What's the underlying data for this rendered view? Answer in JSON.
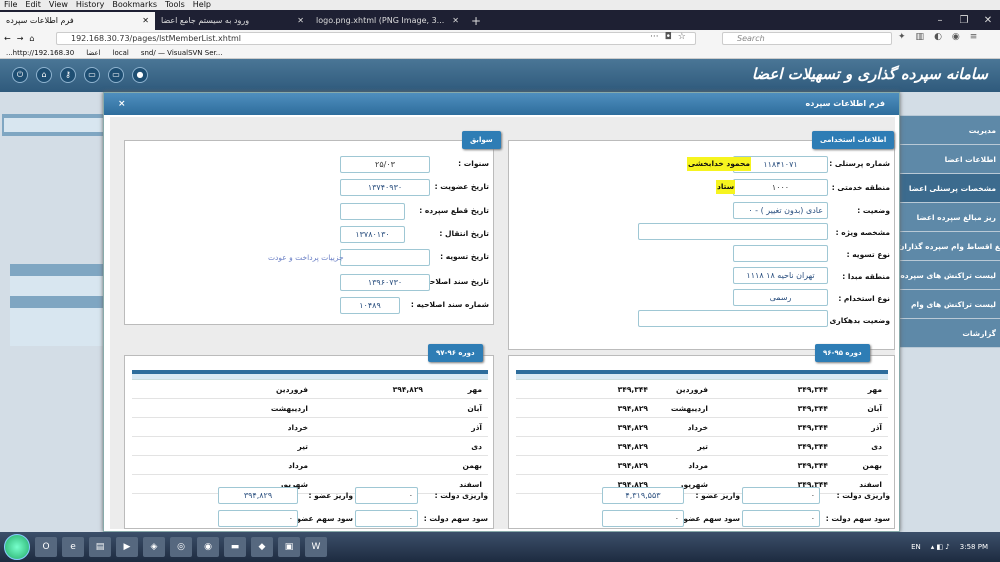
{
  "browser": {
    "menu": [
      "File",
      "Edit",
      "View",
      "History",
      "Bookmarks",
      "Tools",
      "Help"
    ],
    "tabs": [
      {
        "label": "فرم اطلاعات سپرده"
      },
      {
        "label": "ورود به سیستم جامع اعضا"
      },
      {
        "label": "logo.png.xhtml (PNG Image, 3..."
      }
    ],
    "url": "192.168.30.73/pages/lstMemberList.xhtml",
    "search_placeholder": "Search",
    "bookmarks": [
      "...http://192.168.30",
      "اعضا",
      "local",
      "snd/ — VisualSVN Ser..."
    ]
  },
  "app": {
    "title": "سامانه سپرده گذاری و تسهیلات اعضا"
  },
  "sidebar": {
    "items": [
      "مدیریت",
      "اطلاعات اعضا",
      "مشخصات پرسنلی اعضا",
      "ریز مبالغ سپرده اعضا",
      "مبالغ اقساط وام سپرده گذاران",
      "لیست تراکنش های سپرده",
      "لیست تراکنش های وام",
      "گزارشات"
    ]
  },
  "modal": {
    "title": "فرم اطلاعات سپرده",
    "close": "×"
  },
  "employment": {
    "legend": "اطلاعات استخدامی",
    "labels": {
      "personnel": "شماره پرسنلی :",
      "service": "منطقه خدمتی :",
      "status": "وضعیت :",
      "special": "مشخصه ویژه :",
      "settle_type": "نوع تسویه :",
      "origin": "منطقه مبدا :",
      "hire_type": "نوع استخدام :",
      "debt": "وضعیت بدهکاری :"
    },
    "personnel": "۱۱۸۴۱۰۷۱",
    "name": "محمود خدابخشی",
    "service": "۱۰۰۰",
    "service_name": "ستاد",
    "status": "۰ - عادی (بدون تغییر )",
    "special": "",
    "settle_type": "",
    "origin": "۱۱۱۸ تهران ناحیه ۱۸",
    "hire_type": "رسمی",
    "debt": ""
  },
  "history": {
    "legend": "سوابق",
    "labels": {
      "years": "سنوات :",
      "membership_date": "تاریخ عضویت :",
      "cut_date": "تاریخ قطع سپرده :",
      "transfer_date": "تاریخ انتقال :",
      "settle_date": "تاریخ تسویه :",
      "amend_date": "تاریخ سند اصلاحیه :",
      "amend_no": "شماره سند اصلاحیه :"
    },
    "years": "۲۵/۰۳",
    "membership_date": "۱۳۷۴۰۹۳۰",
    "cut_date": "",
    "transfer_date": "۱۳۷۸۰۱۳۰",
    "settle_date": "",
    "amend_date": "۱۳۹۶۰۷۳۰",
    "amend_no": "۱۰۴۸۹",
    "link": "جزییات پرداخت و عودت"
  },
  "period_right": {
    "legend": "دوره ۹۵-۹۶",
    "rows": [
      {
        "m1": "مهر",
        "v1": "۳۴۹,۳۴۴",
        "m2": "فروردین",
        "v2": "۳۴۹,۳۴۴"
      },
      {
        "m1": "آبان",
        "v1": "۳۴۹,۳۴۴",
        "m2": "اردیبهشت",
        "v2": "۳۹۴,۸۲۹"
      },
      {
        "m1": "آذر",
        "v1": "۳۴۹,۳۴۴",
        "m2": "خرداد",
        "v2": "۳۹۴,۸۲۹"
      },
      {
        "m1": "دی",
        "v1": "۳۴۹,۳۴۴",
        "m2": "تیر",
        "v2": "۳۹۴,۸۲۹"
      },
      {
        "m1": "بهمن",
        "v1": "۳۴۹,۳۴۴",
        "m2": "مرداد",
        "v2": "۳۹۴,۸۲۹"
      },
      {
        "m1": "اسفند",
        "v1": "۳۴۹,۳۴۴",
        "m2": "شهریور",
        "v2": "۳۹۴,۸۲۹"
      }
    ],
    "gov_label": "واریزی دولت :",
    "gov": "۰",
    "member_label": "واریز عضو :",
    "member": "۴,۳۱۹,۵۵۳",
    "gov_profit_label": "سود سهم دولت :",
    "gov_profit": "۰",
    "member_profit_label": "سود سهم عضو :",
    "member_profit": "۰"
  },
  "period_left": {
    "legend": "دوره ۹۶-۹۷",
    "rows": [
      {
        "m1": "مهر",
        "v1": "۳۹۴,۸۲۹",
        "m2": "فروردین",
        "v2": ""
      },
      {
        "m1": "آبان",
        "v1": "",
        "m2": "اردیبهشت",
        "v2": ""
      },
      {
        "m1": "آذر",
        "v1": "",
        "m2": "خرداد",
        "v2": ""
      },
      {
        "m1": "دی",
        "v1": "",
        "m2": "تیر",
        "v2": ""
      },
      {
        "m1": "بهمن",
        "v1": "",
        "m2": "مرداد",
        "v2": ""
      },
      {
        "m1": "اسفند",
        "v1": "",
        "m2": "شهریور",
        "v2": ""
      }
    ],
    "gov_label": "واریزی دولت :",
    "gov": "۰",
    "member_label": "واریز عضو :",
    "member": "۳۹۴,۸۲۹",
    "gov_profit_label": "سود سهم دولت :",
    "gov_profit": "۰",
    "member_profit_label": "سود سهم عضو :",
    "member_profit": "۰"
  },
  "taskbar": {
    "lang": "EN",
    "time": "3:58 PM"
  }
}
